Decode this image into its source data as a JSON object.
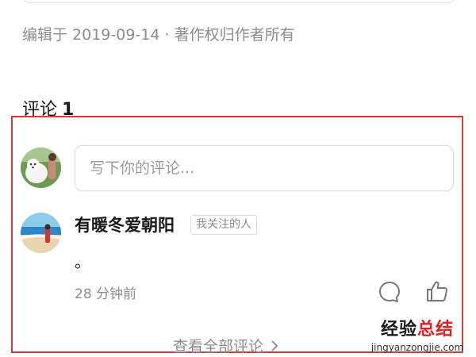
{
  "article": {
    "edit_meta": "编辑于 2019-09-14 · 著作权归作者所有"
  },
  "comments": {
    "heading": "评论",
    "count": "1",
    "input": {
      "placeholder": "写下你的评论..."
    },
    "items": [
      {
        "author": "有暖冬爱朝阳",
        "badge": "我关注的人",
        "text": "。",
        "time": "28 分钟前",
        "actions": [
          "reply-icon",
          "like-icon"
        ]
      }
    ],
    "view_all": "查看全部评论"
  },
  "watermark": {
    "text_part1": "经验",
    "text_part2": "总结",
    "url": "jingyanzongjie.com"
  },
  "colors": {
    "highlight_border": "#d23b3b",
    "muted_text": "#8c8c8c",
    "watermark_red": "#e02020"
  }
}
